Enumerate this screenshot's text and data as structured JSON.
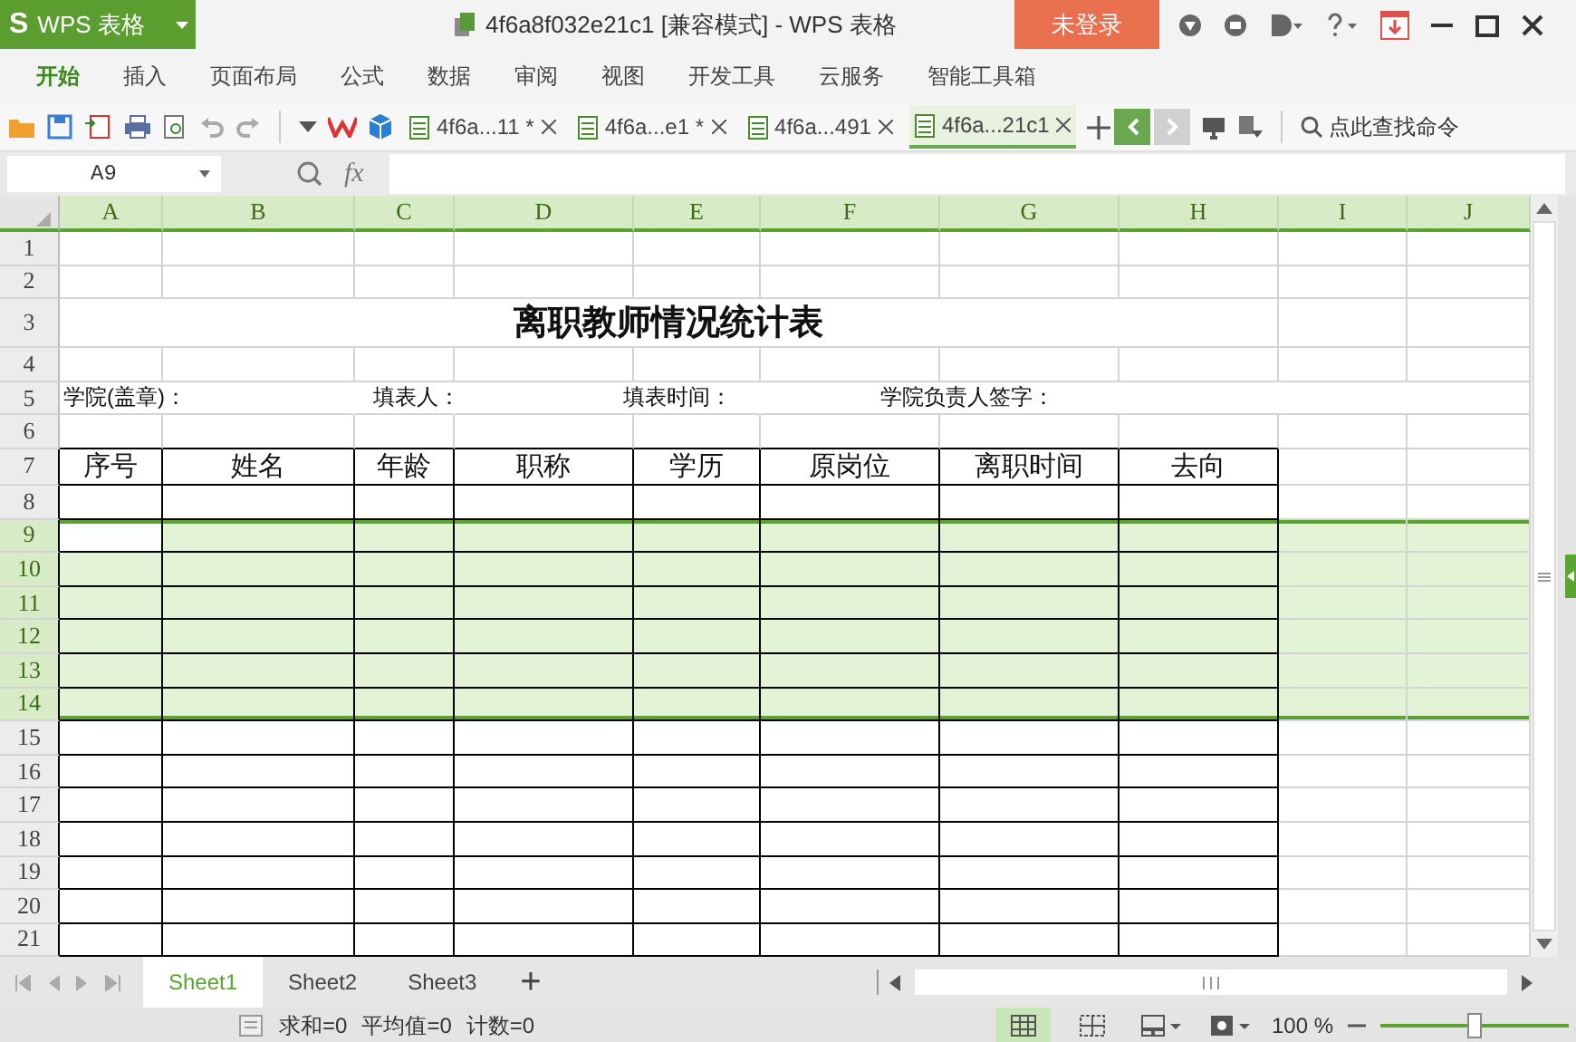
{
  "app_button": {
    "logo": "S",
    "label": "WPS 表格"
  },
  "window": {
    "title": "4f6a8f032e21c1 [兼容模式] - WPS 表格",
    "login_button": "未登录"
  },
  "ribbon_tabs": [
    {
      "label": "开始",
      "selected": true
    },
    {
      "label": "插入",
      "selected": false
    },
    {
      "label": "页面布局",
      "selected": false
    },
    {
      "label": "公式",
      "selected": false
    },
    {
      "label": "数据",
      "selected": false
    },
    {
      "label": "审阅",
      "selected": false
    },
    {
      "label": "视图",
      "selected": false
    },
    {
      "label": "开发工具",
      "selected": false
    },
    {
      "label": "云服务",
      "selected": false
    },
    {
      "label": "智能工具箱",
      "selected": false
    }
  ],
  "doc_tabs": [
    {
      "label": "4f6a...11 *",
      "selected": false
    },
    {
      "label": "4f6a...e1 *",
      "selected": false
    },
    {
      "label": "4f6a...491",
      "selected": false
    },
    {
      "label": "4f6a...21c1",
      "selected": true
    }
  ],
  "command_search": {
    "placeholder": "点此查找命令"
  },
  "formula_bar": {
    "cell_ref": "A9",
    "fx": "fx"
  },
  "grid": {
    "columns": [
      "A",
      "B",
      "C",
      "D",
      "E",
      "F",
      "G",
      "H",
      "I",
      "J"
    ],
    "rows": [
      {
        "number": "1",
        "selected": false
      },
      {
        "number": "2",
        "selected": false
      },
      {
        "number": "3",
        "selected": false
      },
      {
        "number": "4",
        "selected": false
      },
      {
        "number": "5",
        "selected": false
      },
      {
        "number": "6",
        "selected": false
      },
      {
        "number": "7",
        "selected": false
      },
      {
        "number": "8",
        "selected": false
      },
      {
        "number": "9",
        "selected": true
      },
      {
        "number": "10",
        "selected": true
      },
      {
        "number": "11",
        "selected": true
      },
      {
        "number": "12",
        "selected": true
      },
      {
        "number": "13",
        "selected": true
      },
      {
        "number": "14",
        "selected": true
      },
      {
        "number": "15",
        "selected": false
      },
      {
        "number": "16",
        "selected": false
      },
      {
        "number": "17",
        "selected": false
      },
      {
        "number": "18",
        "selected": false
      },
      {
        "number": "19",
        "selected": false
      },
      {
        "number": "20",
        "selected": false
      },
      {
        "number": "21",
        "selected": false
      }
    ],
    "title": "离职教师情况统计表",
    "info_fields": [
      "学院(盖章)：",
      "填表人：",
      "填表时间：",
      "学院负责人签字："
    ],
    "headers": [
      "序号",
      "姓名",
      "年龄",
      "职称",
      "学历",
      "原岗位",
      "离职时间",
      "去向"
    ]
  },
  "sheet_tabs": [
    {
      "label": "Sheet1",
      "selected": true
    },
    {
      "label": "Sheet2",
      "selected": false
    },
    {
      "label": "Sheet3",
      "selected": false
    }
  ],
  "add_sheet": "+",
  "status_bar": {
    "sum": "求和=0",
    "average": "平均值=0",
    "count": "计数=0",
    "zoom": "100 %",
    "zoom_slider": {
      "level": 0.5
    }
  }
}
